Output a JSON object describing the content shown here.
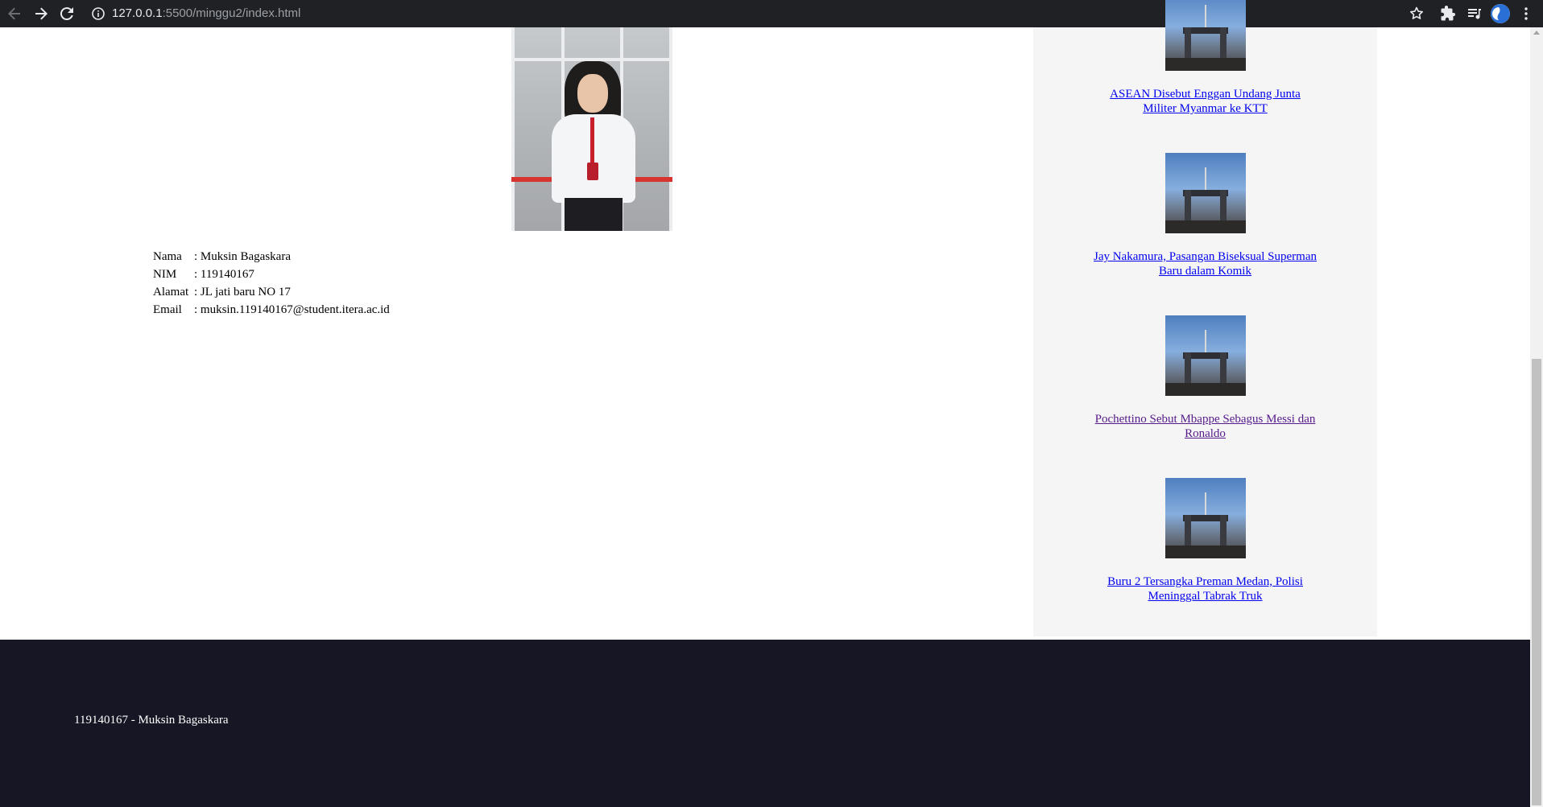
{
  "browser": {
    "url_host": "127.0.0.1",
    "url_rest": ":5500/minggu2/index.html"
  },
  "profile": {
    "rows": [
      {
        "label": "Nama",
        "value": ": Muksin Bagaskara"
      },
      {
        "label": "NIM",
        "value": ": 119140167"
      },
      {
        "label": "Alamat",
        "value": ": JL jati baru NO 17"
      },
      {
        "label": "Email",
        "value": ": muksin.119140167@student.itera.ac.id"
      }
    ]
  },
  "news": [
    {
      "title": "ASEAN Disebut Enggan Undang Junta Militer Myanmar ke KTT",
      "visited": false
    },
    {
      "title": "Jay Nakamura, Pasangan Biseksual Superman Baru dalam Komik",
      "visited": false
    },
    {
      "title": "Pochettino Sebut Mbappe Sebagus Messi dan Ronaldo",
      "visited": true
    },
    {
      "title": "Buru 2 Tersangka Preman Medan, Polisi Meninggal Tabrak Truk",
      "visited": false
    }
  ],
  "footer": {
    "text": "119140167 - Muksin Bagaskara"
  },
  "colors": {
    "chrome_bg": "#202124",
    "link": "#0000ee",
    "visited_link": "#551a8b",
    "sidebar_bg": "#f5f5f5",
    "footer_bg": "#161625"
  }
}
